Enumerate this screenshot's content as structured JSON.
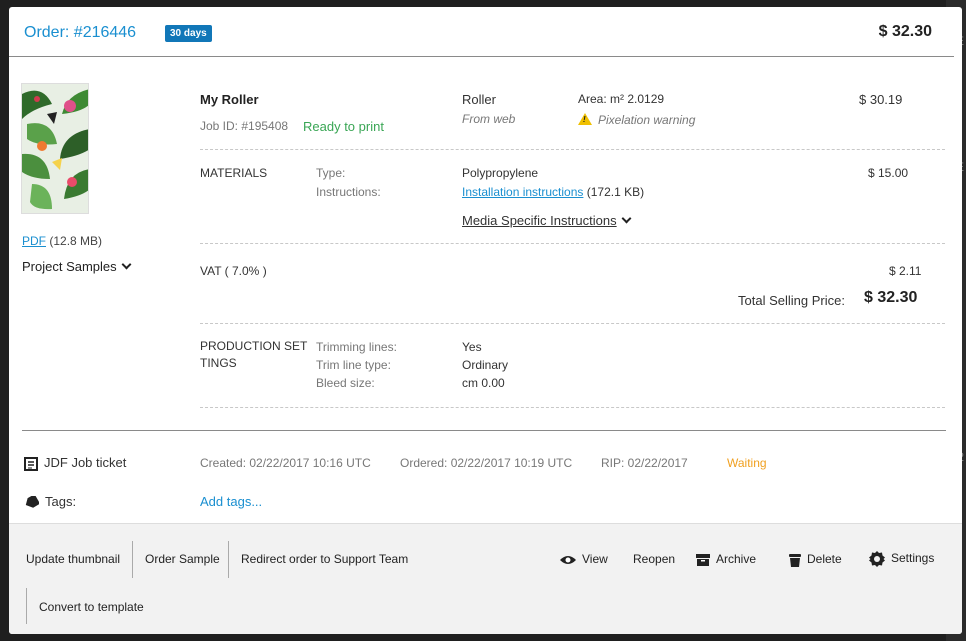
{
  "header": {
    "order_number": "Order: #216446",
    "badge": "30 days",
    "total": "$ 32.30"
  },
  "file": {
    "pdf_label": "PDF",
    "pdf_size": "(12.8 MB)",
    "project_samples": "Project Samples"
  },
  "job": {
    "name": "My Roller",
    "job_id": "Job ID: #195408",
    "status": "Ready to print",
    "product": "Roller",
    "source": "From web",
    "area": "Area: m² 2.0129",
    "warning": "Pixelation warning",
    "price": "$ 30.19"
  },
  "materials": {
    "section": "MATERIALS",
    "type_label": "Type:",
    "instructions_label": "Instructions:",
    "type_value": "Polypropylene",
    "instructions_link": "Installation instructions",
    "instructions_size": "(172.1 KB)",
    "media_instructions": "Media Specific Instructions",
    "price": "$ 15.00"
  },
  "vat": {
    "label": "VAT ( 7.0% )",
    "price": "$ 2.11",
    "total_label": "Total Selling Price:",
    "total_value": "$ 32.30"
  },
  "production": {
    "section_line1": "PRODUCTION SET",
    "section_line2": "TINGS",
    "trimming_label": "Trimming lines:",
    "trim_type_label": "Trim line type:",
    "bleed_label": "Bleed size:",
    "trimming_value": "Yes",
    "trim_type_value": "Ordinary",
    "bleed_value": "cm 0.00"
  },
  "ticket": {
    "label": "JDF Job ticket",
    "created": "Created: 02/22/2017 10:16 UTC",
    "ordered": "Ordered: 02/22/2017 10:19 UTC",
    "rip": "RIP:  02/22/2017",
    "rip_status": "Waiting",
    "tags_label": "Tags:",
    "add_tags": "Add tags..."
  },
  "footer": {
    "update_thumbnail": "Update thumbnail",
    "order_sample": "Order Sample",
    "redirect": "Redirect order to Support Team",
    "view": "View",
    "reopen": "Reopen",
    "archive": "Archive",
    "delete": "Delete",
    "settings": "Settings",
    "convert": "Convert to template"
  },
  "colors": {
    "accent": "#1a8fd0",
    "badge": "#1177b8",
    "ready": "#3aa655",
    "waiting": "#f0a020"
  }
}
